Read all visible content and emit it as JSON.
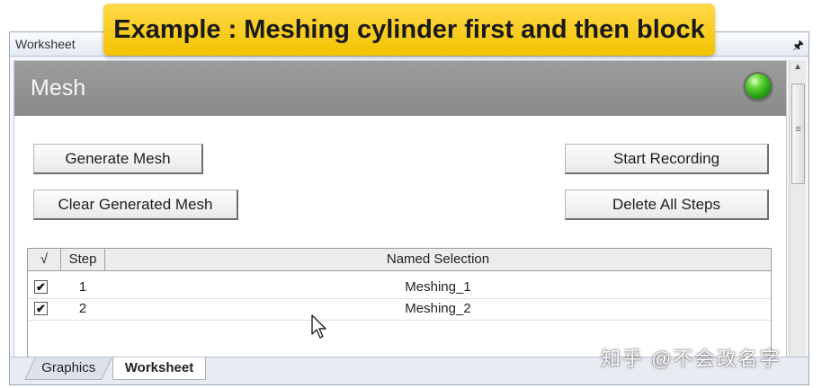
{
  "banner": {
    "text": "Example : Meshing cylinder first and then block"
  },
  "panel": {
    "title": "Worksheet",
    "pin_icon": "pin-icon"
  },
  "mesh": {
    "title": "Mesh",
    "status_color": "#3cc41e",
    "buttons": {
      "generate": "Generate Mesh",
      "clear": "Clear Generated Mesh",
      "start_recording": "Start Recording",
      "delete_all": "Delete All Steps"
    }
  },
  "table": {
    "headers": {
      "check": "√",
      "step": "Step",
      "named_selection": "Named Selection"
    },
    "rows": [
      {
        "checked": true,
        "check_mark": "✔",
        "step": "1",
        "named_selection": "Meshing_1"
      },
      {
        "checked": true,
        "check_mark": "✔",
        "step": "2",
        "named_selection": "Meshing_2"
      }
    ]
  },
  "tabs": {
    "graphics": "Graphics",
    "worksheet": "Worksheet",
    "active": "Worksheet"
  },
  "scrollbar": {
    "up": "▲",
    "down": "▼",
    "grip": "≡"
  },
  "watermark": {
    "text": "知乎 @不会改名字"
  }
}
